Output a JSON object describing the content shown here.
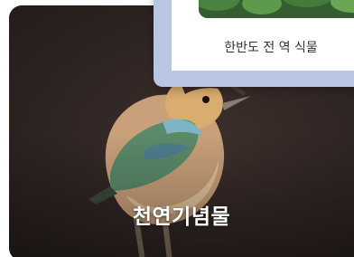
{
  "cards": {
    "main": {
      "title": "천연기념물",
      "image_icon": "bird-photo"
    },
    "overlay": {
      "caption": "한반도 전 역 식물",
      "image_icon": "plant-photo"
    }
  }
}
